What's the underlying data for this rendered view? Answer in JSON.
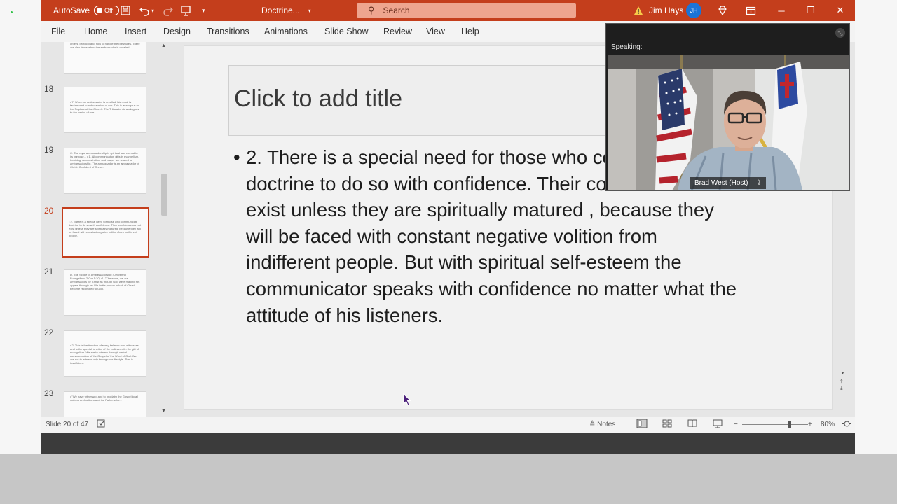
{
  "titlebar": {
    "autosave_label": "AutoSave",
    "autosave_state": "Off",
    "file_name": "Doctrine...",
    "search_placeholder": "Search",
    "warning_icon": "warning-icon",
    "user_name": "Jim Hays",
    "user_initials": "JH",
    "accent_color": "#c43e1c"
  },
  "ribbon": {
    "tabs": [
      "File",
      "Home",
      "Insert",
      "Design",
      "Transitions",
      "Animations",
      "Slide Show",
      "Review",
      "View",
      "Help"
    ]
  },
  "thumbnails": [
    {
      "number": "",
      "text": "Spiritual perspective. The Lord Jesus Christ is the embassy of that ambassadorship and must rely upon the Lord for everything. The divine system includes orders, protocol and how to handle the pressures. There are also times when the ambassador is recalled..."
    },
    {
      "number": "18",
      "text": "• 7. When an ambassador is recalled, his recall is tantamount to a declaration of war. This is analogous to the Rapture of the Church. The Tribulation is analogous to the period of war."
    },
    {
      "number": "19",
      "text": "C. The royal ambassadorship is spiritual and eternal in its purpose... • 1. All communication gifts in evangelism, teaching, administration, and prayer are related to ambassadorship. The ambassador is an ambassador of Christ. Confident of Christ..."
    },
    {
      "number": "20",
      "text": "• 2. There is a special need for those who communicate doctrine to do so with confidence. Their confidence cannot exist unless they are spiritually matured, because they will be faced with constant negative volition from indifferent people."
    },
    {
      "number": "21",
      "text": "D. The Scope of Ambassadorship (Delivering Evangelism, 2 Cor 5:20) •1. \"Therefore, we are ambassadors for Christ as though God were making His appeal through us. We invite you on behalf of Christ, become reconciled to God.\""
    },
    {
      "number": "22",
      "text": "• 2. This is the function of every believer who witnesses and is the special function of the believer with the gift of evangelism. We are to witness through verbal communication of the Gospel of the Word of God. We are not to witness only through our lifestyle. That is insufficient."
    },
    {
      "number": "23",
      "text": "• \"We have witnessed and to proclaim the Gospel to all nations and nations and the Father who..."
    }
  ],
  "slide": {
    "title_placeholder": "Click to add title",
    "bullet": "•",
    "body": "2. There is a special need for those who communicate doctrine to do so with confidence. Their confidence cannot exist unless they are spiritually matured , because they will be faced with constant negative volition from indifferent people. But with spiritual self-esteem the communicator speaks with confidence no matter what the attitude of his listeners."
  },
  "zoom": {
    "speaking_label": "Speaking:",
    "host_label": "Brad West (Host)"
  },
  "statusbar": {
    "slide_position": "Slide 20 of 47",
    "notes_label": "Notes",
    "zoom_level": "80%",
    "zoom_fraction": 0.72
  }
}
